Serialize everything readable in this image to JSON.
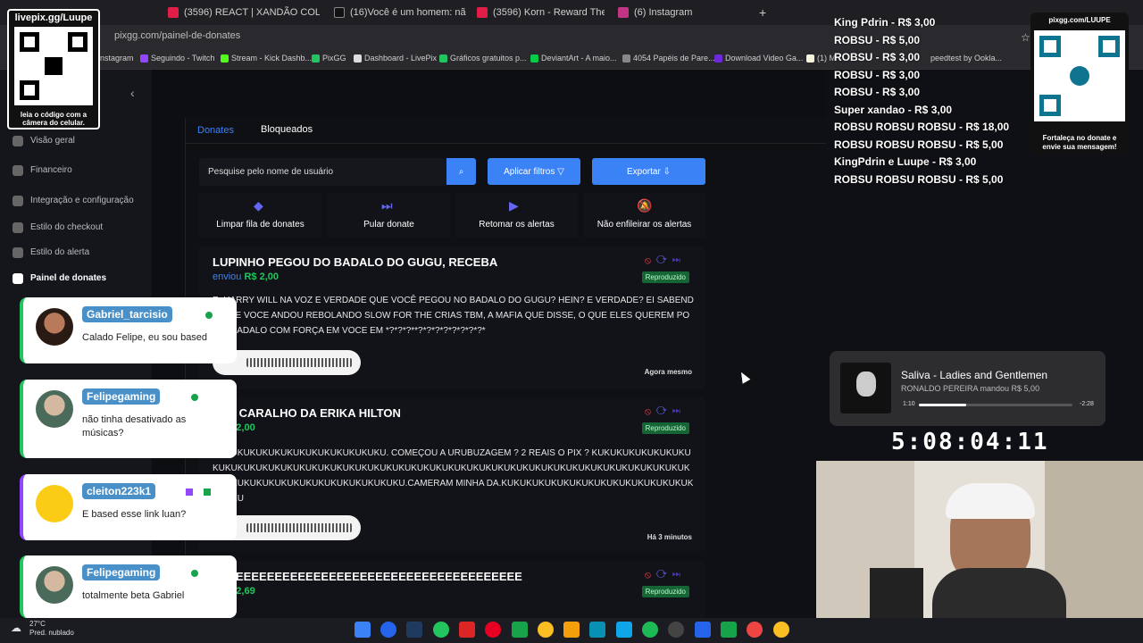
{
  "browser": {
    "tabs": [
      {
        "label": "(3596) REACT | XANDÃO COLO"
      },
      {
        "label": "(16)Você é um homem: não de"
      },
      {
        "label": "(3596) Korn - Reward The Scars"
      },
      {
        "label": "(6) Instagram"
      }
    ],
    "url": "pixgg.com/painel-de-donates",
    "bookmarks": [
      "nstagram",
      "Seguindo - Twitch",
      "Stream - Kick Dashb...",
      "PixGG",
      "Dashboard - LivePix",
      "Gráficos gratuitos p...",
      "DeviantArt - A maio...",
      "4054 Papéis de Pare...",
      "Download Video Ga...",
      "(1) M",
      "peedtest by Ookla..."
    ]
  },
  "sidebar": {
    "items": [
      {
        "label": "Visão geral"
      },
      {
        "label": "Financeiro"
      },
      {
        "label": "Integração e configuração"
      },
      {
        "label": "Estilo do checkout"
      },
      {
        "label": "Estilo do alerta"
      },
      {
        "label": "Painel de donates"
      }
    ]
  },
  "panel": {
    "tabs": [
      {
        "label": "Donates"
      },
      {
        "label": "Bloqueados"
      }
    ],
    "search_placeholder": "Pesquise pelo nome de usuário",
    "filter_label": "Aplicar filtros",
    "export_label": "Exportar",
    "actions": [
      {
        "label": "Limpar fila de donates"
      },
      {
        "label": "Pular donate"
      },
      {
        "label": "Retomar os alertas"
      },
      {
        "label": "Não enfileirar os alertas"
      }
    ]
  },
  "donates": [
    {
      "title": "LUPINHO PEGOU DO BADALO DO GUGU, RECEBA",
      "sent": "enviou",
      "amount": "R$ 2,00",
      "status": "Reproduzido",
      "message": "E, HARRY WILL NA VOZ E VERDADE QUE VOCÊ PEGOU NO BADALO DO GUGU? HEIN? E VERDADE? EI SABENDO QUE VOCE ANDOU REBOLANDO SLOW FOR THE CRIAS TBM, A MAFIA QUE DISSE, O QUE ELES QUEREM POR O BADALO COM FORÇA EM VOCE EM *?*?*?**?*?*?*?*?*?*?*?*",
      "time": "Agora mesmo"
    },
    {
      "title": "EI O CARALHO DA ERIKA HILTON",
      "sent": "u",
      "amount": "R$ 2,00",
      "status": "Reproduzido",
      "message": "KUKUKUKUKUKUKUKUKUKUKUKUKUKU. COMEÇOU A URUBUZAGEM ? 2 REAIS O PIX ? KUKUKUKUKUKUKUKUKUKUKUKUKUKUKUKUKUKUKUKUKUKUKUKUKUKUKUKUKUKUKUKUKUKUKUKUKUKUKUKUKUKUKUKUKUKUKUKUKUKUKUKUKUKUKUKUKUKUKUKUKUKU.CAMERAM MINHA DA.KUKUKUKUKUKUKUKUKUKUKUKUKUKUKUKUKUKU",
      "time": "Há 3 minutos"
    },
    {
      "title": "EEEEEEEEEEEEEEEEEEEEEEEEEEEEEEEEEEEEEEEE",
      "sent": "u",
      "amount": "R$ 2,69",
      "status": "Reproduzido",
      "message": "",
      "time": ""
    }
  ],
  "overlay": {
    "qr_left_title": "livepix.gg/Luupe",
    "qr_left_caption": "leia o código com a câmera do celular.",
    "qr_right_title": "pixgg.com/LUUPE",
    "qr_right_caption": "Fortaleça no donate e envie sua mensagem!",
    "top_donors": [
      "King Pdrin - R$ 3,00",
      "ROBSU - R$ 5,00",
      "ROBSU - R$ 3,00",
      "ROBSU - R$ 3,00",
      "ROBSU - R$ 3,00",
      "Super xandao - R$ 3,00",
      "ROBSU ROBSU ROBSU - R$ 18,00",
      "ROBSU ROBSU ROBSU - R$ 5,00",
      "KingPdrin e Luupe - R$ 3,00",
      "ROBSU ROBSU ROBSU - R$ 5,00"
    ],
    "chat": [
      {
        "user": "Gabriel_tarcisio",
        "text": "Calado Felipe, eu sou based",
        "color": "#5a8fc0"
      },
      {
        "user": "Felipegaming",
        "text": "não tinha desativado as músicas?",
        "color": "#5a8fc0"
      },
      {
        "user": "cleiton223k1",
        "text": "E based esse link luan?",
        "color": "#5a8fc0"
      },
      {
        "user": "Felipegaming",
        "text": "totalmente beta Gabriel",
        "color": "#5a8fc0"
      }
    ],
    "spotify": {
      "song": "Saliva - Ladies and Gentlemen",
      "sender": "RONALDO PEREIRA mandou R$ 5,00",
      "elapsed": "1:10",
      "remaining": "-2:28",
      "progress": 0.31
    },
    "timer": "5:08:04:11"
  },
  "taskbar": {
    "weather_temp": "27°C",
    "weather_desc": "Pred. nublado"
  },
  "colors": {
    "accent": "#3b82f6",
    "success": "#22c55e"
  }
}
